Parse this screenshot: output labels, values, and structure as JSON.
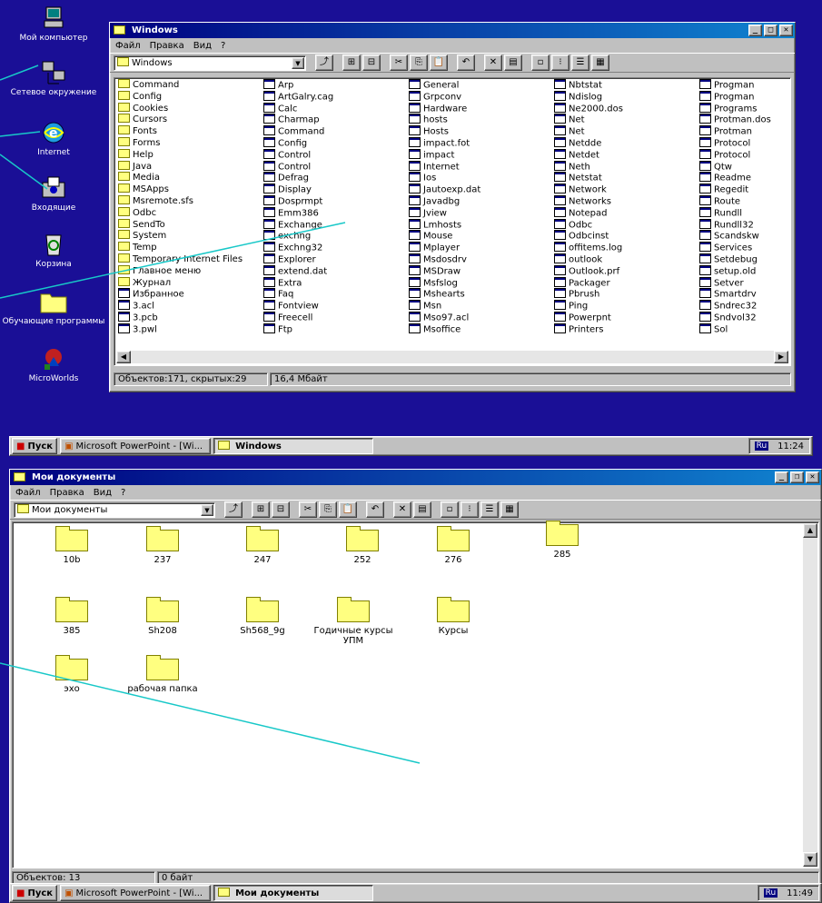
{
  "desktop": {
    "icons": [
      {
        "label": "Мой компьютер",
        "icon": "computer-icon"
      },
      {
        "label": "Сетевое окружение",
        "icon": "network-icon"
      },
      {
        "label": "Internet",
        "icon": "internet-icon"
      },
      {
        "label": "Входящие",
        "icon": "inbox-icon"
      },
      {
        "label": "Корзина",
        "icon": "recycle-bin-icon"
      },
      {
        "label": "Обучающие программы",
        "icon": "folder-icon"
      },
      {
        "label": "MicroWorlds",
        "icon": "microworlds-icon"
      }
    ]
  },
  "window1": {
    "title": "Windows",
    "menu": {
      "file": "Файл",
      "edit": "Правка",
      "view": "Вид",
      "help": "?"
    },
    "address": "Windows",
    "columns": [
      [
        "Command",
        "Config",
        "Cookies",
        "Cursors",
        "Fonts",
        "Forms",
        "Help",
        "Java",
        "Media",
        "MSApps",
        "Msremote.sfs",
        "Odbc",
        "SendTo",
        "System",
        "Temp",
        "Temporary Internet Files",
        "Главное меню",
        "Журнал",
        "Избранное",
        "3.acl",
        "3.pcb",
        "3.pwl"
      ],
      [
        "Arp",
        "ArtGalry.cag",
        "Calc",
        "Charmap",
        "Command",
        "Config",
        "Control",
        "Control",
        "Defrag",
        "Display",
        "Dosprmpt",
        "Emm386",
        "Exchange",
        "exchng",
        "Exchng32",
        "Explorer",
        "extend.dat",
        "Extra",
        "Faq",
        "Fontview",
        "Freecell",
        "Ftp"
      ],
      [
        "General",
        "Grpconv",
        "Hardware",
        "hosts",
        "Hosts",
        "impact.fot",
        "impact",
        "Internet",
        "Ios",
        "Jautoexp.dat",
        "Javadbg",
        "Jview",
        "Lmhosts",
        "Mouse",
        "Mplayer",
        "Msdosdrv",
        "MSDraw",
        "Msfslog",
        "Mshearts",
        "Msn",
        "Mso97.acl",
        "Msoffice"
      ],
      [
        "Nbtstat",
        "Ndislog",
        "Ne2000.dos",
        "Net",
        "Net",
        "Netdde",
        "Netdet",
        "Neth",
        "Netstat",
        "Network",
        "Networks",
        "Notepad",
        "Odbc",
        "Odbcinst",
        "offitems.log",
        "outlook",
        "Outlook.prf",
        "Packager",
        "Pbrush",
        "Ping",
        "Powerpnt",
        "Printers"
      ],
      [
        "Progman",
        "Progman",
        "Programs",
        "Protman.dos",
        "Protman",
        "Protocol",
        "Protocol",
        "Qtw",
        "Readme",
        "Regedit",
        "Route",
        "Rundll",
        "Rundll32",
        "Scandskw",
        "Services",
        "Setdebug",
        "setup.old",
        "Setver",
        "Smartdrv",
        "Sndrec32",
        "Sndvol32",
        "Sol"
      ]
    ],
    "status": {
      "count": "Объектов:171, скрытых:29",
      "size": "16,4 Мбайт"
    }
  },
  "taskbar1": {
    "start": "Пуск",
    "tasks": [
      "Microsoft PowerPoint - [Wi...",
      "Windows"
    ],
    "lang": "Ru",
    "time": "11:24"
  },
  "window2": {
    "title": "Мои документы",
    "menu": {
      "file": "Файл",
      "edit": "Правка",
      "view": "Вид",
      "help": "?"
    },
    "address": "Мои документы",
    "folders": [
      "10b",
      "237",
      "247",
      "252",
      "276",
      "285",
      "385",
      "Sh208",
      "Sh568_9g",
      "Годичные курсы УПМ",
      "Курсы",
      "эхо",
      "рабочая папка"
    ],
    "status": {
      "count": "Объектов: 13",
      "size": "0 байт"
    }
  },
  "taskbar2": {
    "start": "Пуск",
    "tasks": [
      "Microsoft PowerPoint - [Wi...",
      "Мои документы"
    ],
    "lang": "Ru",
    "time": "11:49"
  },
  "colors": {
    "desktop": "#1a0f96",
    "titlebar": "#000080",
    "window": "#c0c0c0",
    "annotation": "#18c8c8"
  }
}
